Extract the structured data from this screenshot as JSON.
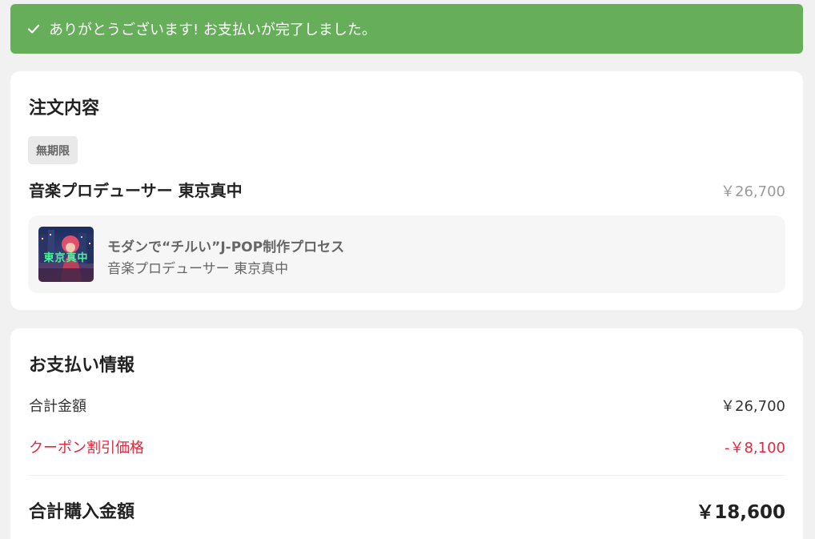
{
  "banner": {
    "icon": "check-icon",
    "color": "#66ae5a",
    "message": "ありがとうございます! お支払いが完了しました。"
  },
  "order": {
    "title": "注文内容",
    "tag": "無期限",
    "product_name": "音楽プロデューサー 東京真中",
    "product_price": "￥26,700",
    "item": {
      "title": "モダンで“チルい”J-POP制作プロセス",
      "author": "音楽プロデューサー 東京真中",
      "thumbnail_text": "東京真中"
    }
  },
  "payment": {
    "title": "お支払い情報",
    "subtotal_label": "合計金額",
    "subtotal_value": "￥26,700",
    "coupon_label": "クーポン割引価格",
    "coupon_value": "-￥8,100",
    "coupon_color": "#e0283f",
    "total_label": "合計購入金額",
    "total_value": "￥18,600"
  }
}
